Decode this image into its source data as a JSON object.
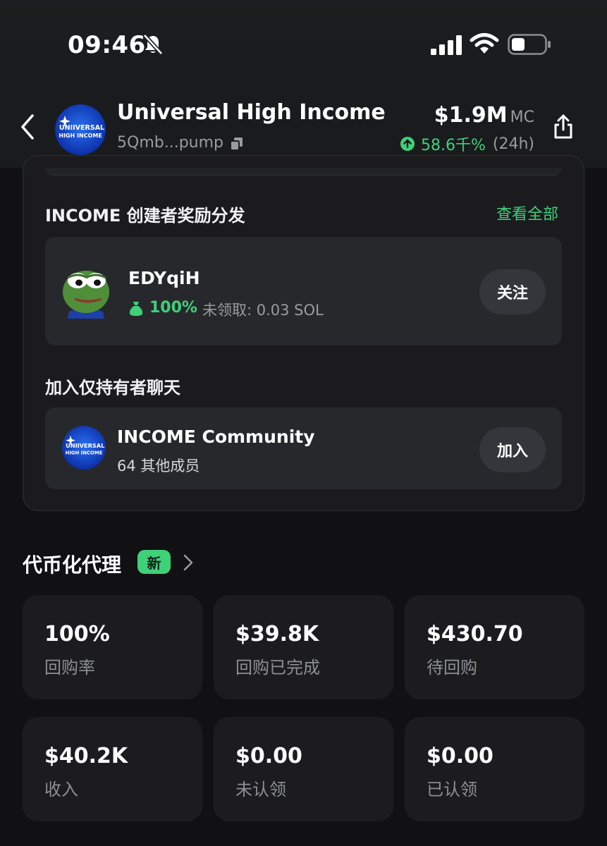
{
  "status_bar": {
    "time": "09:46"
  },
  "header": {
    "token_name": "Universal High Income",
    "address": "5Qmb...pump",
    "market_cap": "$1.9M",
    "market_cap_label": "MC",
    "change": "58.6千%",
    "change_period": "(24h)",
    "logo_text_line1": "UNIIVERSAL",
    "logo_text_line2": "HIGH INCOME"
  },
  "creator_rewards": {
    "title": "INCOME 创建者奖励分发",
    "view_all": "查看全部",
    "creator": {
      "name": "EDYqiH",
      "percent": "100%",
      "unclaimed": "未领取: 0.03 SOL",
      "follow_label": "关注"
    }
  },
  "holders_chat": {
    "title": "加入仅持有者聊天",
    "community_name": "INCOME Community",
    "members": "64 其他成员",
    "join_label": "加入"
  },
  "agent": {
    "title": "代币化代理",
    "badge": "新",
    "stats": [
      {
        "value": "100%",
        "label": "回购率"
      },
      {
        "value": "$39.8K",
        "label": "回购已完成"
      },
      {
        "value": "$430.70",
        "label": "待回购"
      },
      {
        "value": "$40.2K",
        "label": "收入"
      },
      {
        "value": "$0.00",
        "label": "未认领"
      },
      {
        "value": "$0.00",
        "label": "已认领"
      }
    ]
  },
  "colors": {
    "accent_green": "#3fd07a",
    "background": "#111113",
    "card": "#1c1c1f"
  }
}
